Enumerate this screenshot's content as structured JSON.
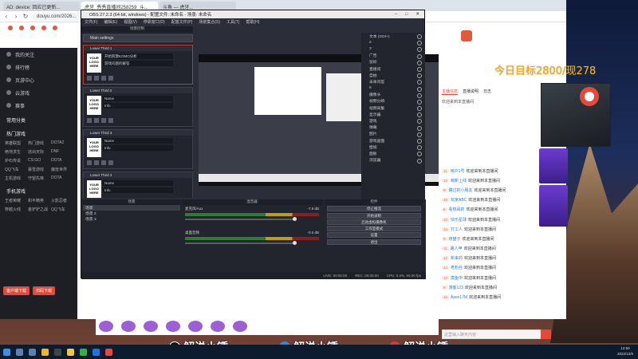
{
  "browser": {
    "tabs": [
      "AD: device: 回应已更新...",
      "虎牙_秀秀直播间258259_斗...",
      "斗鱼 — 虎牙..."
    ],
    "url": "douyu.com/2026..."
  },
  "douyu_sidebar": {
    "items": [
      "我的关注",
      "排行榜",
      "页游中心",
      "云游戏",
      "赛事"
    ],
    "section_common": "常用分类",
    "section_hot": "热门游戏",
    "section_mobile": "手机游戏",
    "grid_labels": [
      "英雄联盟",
      "热门游戏",
      "DOTA2",
      "绝地求生",
      "逃出天际",
      "DNF",
      "炉石传说",
      "CS:GO",
      "DOTA",
      "QQ飞车",
      "暴雪游戏",
      "魔兽世界",
      "主机游戏",
      "守望先锋",
      "DOTA"
    ],
    "mobile_labels": [
      "王者荣耀",
      "和平精英",
      "火影忍者",
      "穿越火线",
      "金铲铲之战",
      "QQ飞车"
    ],
    "bottom_buttons": [
      "客户端下载",
      "扫码下载"
    ]
  },
  "obs": {
    "title": "OBS 27.2.3 (64-bit, windows) - 配置文件: 未命名 - 场景: 未命名",
    "menu": [
      "文件(F)",
      "编辑(E)",
      "视图(V)",
      "停靠窗口(D)",
      "配置文件(P)",
      "场景集合(S)",
      "工具(T)",
      "帮助(H)"
    ],
    "dock_title": "场景控制",
    "main_settings": "Main settings",
    "lower_thirds": [
      {
        "name": "Lower Third 1",
        "line1": "开始刺激KOMO分析",
        "line2": "游戏问题的解答"
      },
      {
        "name": "Lower Third 2",
        "line1": "Name",
        "line2": "Info"
      },
      {
        "name": "Lower Third 3",
        "line1": "Name",
        "line2": "Info"
      },
      {
        "name": "Lower Third 4",
        "line1": "Name",
        "line2": "Info"
      }
    ],
    "logo_text": "YOUR LOGO HERE",
    "sources": [
      "文本 (GDI+)",
      "2",
      "3",
      "广告",
      "鼠标",
      "直播间",
      "自拍",
      "未来问答",
      "5",
      "摄像头",
      "视频分辨",
      "视频采集",
      "显示器",
      "游戏",
      "弹幕",
      "图片",
      "游戏画面",
      "壁纸",
      "面板",
      "浏览器"
    ],
    "scenes_title": "场景",
    "scenes": [
      "场景",
      "场景 2",
      "场景 3"
    ],
    "mixer_title": "混音器",
    "tracks": [
      {
        "name": "麦克风/Aux",
        "db": "-7.9 dB"
      },
      {
        "name": "桌面音频",
        "db": "-0.0 dB"
      }
    ],
    "controls_title": "控件",
    "controls": [
      "停止推流",
      "开始录制",
      "启动虚拟摄像机",
      "工作室模式",
      "设置",
      "退出"
    ],
    "status": [
      "LIVE: 00:00:00",
      "REC: 00:00:00",
      "CPU: 5.2%, 60.00 fps"
    ],
    "preview_label": "未选择源"
  },
  "right_panel": {
    "tabs": [
      "主播信息",
      "直播说明",
      "日志"
    ],
    "notice": "欢迎来到本直播间",
    "chat_rows": [
      {
        "lv": "11",
        "name": "用户1号",
        "text": "欢迎来到本直播间"
      },
      {
        "lv": "12",
        "name": "萌新上线",
        "text": "欢迎来到本直播间"
      },
      {
        "lv": "9",
        "name": "路过的小朋友",
        "text": "欢迎来到本直播间"
      },
      {
        "lv": "15",
        "name": "玩家ABC",
        "text": "欢迎来到本直播间"
      },
      {
        "lv": "8",
        "name": "看热闹的",
        "text": "欢迎来到本直播间"
      },
      {
        "lv": "10",
        "name": "快乐星球",
        "text": "欢迎来到本直播间"
      },
      {
        "lv": "13",
        "name": "打工人",
        "text": "欢迎来到本直播间"
      },
      {
        "lv": "9",
        "name": "夜猫子",
        "text": "欢迎来到本直播间"
      },
      {
        "lv": "11",
        "name": "路人甲",
        "text": "欢迎来到本直播间"
      },
      {
        "lv": "12",
        "name": "新来的",
        "text": "欢迎来到本直播间"
      },
      {
        "lv": "14",
        "name": "老粉丝",
        "text": "欢迎来到本直播间"
      },
      {
        "lv": "10",
        "name": "摸鱼中",
        "text": "欢迎来到本直播间"
      },
      {
        "lv": "9",
        "name": "游客123",
        "text": "欢迎来到本直播间"
      },
      {
        "lv": "16",
        "name": "Apex17M",
        "text": "欢迎来到本直播间"
      }
    ],
    "input_placeholder": "这里输入聊天内容"
  },
  "overlay_title": "今日目标2800/现278",
  "brands": [
    "解说小锺",
    "解说小锺",
    "解说小锺"
  ],
  "clock": {
    "time": "12:59",
    "date": "2022/12/5"
  }
}
